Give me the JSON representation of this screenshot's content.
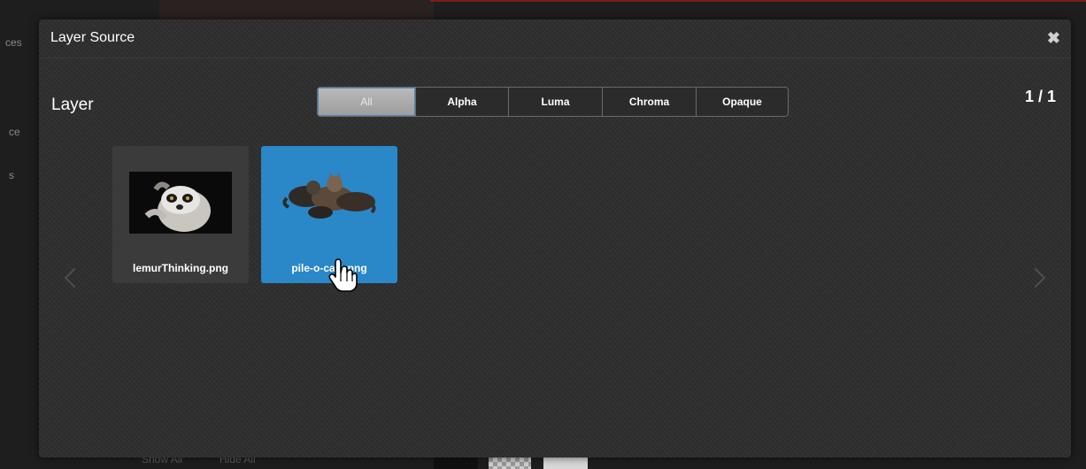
{
  "background": {
    "side_labels": [
      "ces",
      "ce",
      "s"
    ],
    "bottom_links": [
      "Show All",
      "Hide All"
    ]
  },
  "modal": {
    "title": "Layer Source",
    "close_icon": "close-icon",
    "section_label": "Layer",
    "page_indicator": "1 / 1",
    "filters": [
      "All",
      "Alpha",
      "Luma",
      "Chroma",
      "Opaque"
    ],
    "active_filter": "All",
    "items": [
      {
        "label": "lemurThinking.png",
        "selected": false
      },
      {
        "label": "pile-o-cats.png",
        "selected": true
      }
    ]
  },
  "colors": {
    "modal_bg": "#2d2d2d",
    "selected_item": "#2a87c8",
    "item_bg": "#3b3b3b"
  }
}
